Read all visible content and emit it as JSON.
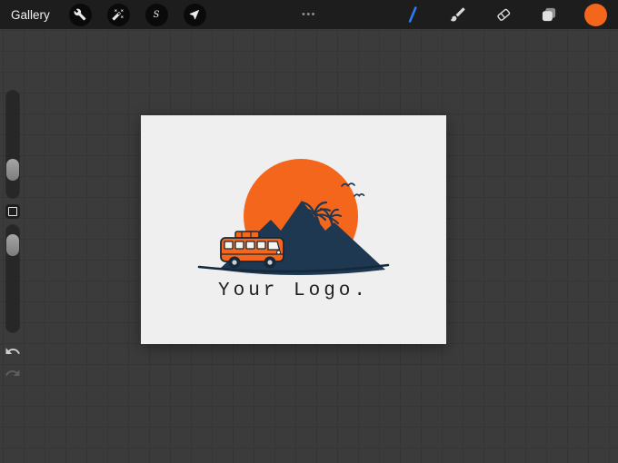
{
  "topbar": {
    "gallery_label": "Gallery",
    "more_glyph": "•••",
    "selection_glyph": "S",
    "left_tools": [
      {
        "name": "actions",
        "icon": "wrench-icon"
      },
      {
        "name": "adjustments",
        "icon": "magic-wand-icon"
      },
      {
        "name": "selection",
        "icon": "selection-s-icon"
      },
      {
        "name": "transform",
        "icon": "transform-arrow-icon"
      }
    ],
    "right_tools": [
      {
        "name": "stroke",
        "icon": "brush-stroke-icon"
      },
      {
        "name": "brush",
        "icon": "paintbrush-icon"
      },
      {
        "name": "erase",
        "icon": "eraser-icon"
      },
      {
        "name": "layers",
        "icon": "layers-icon"
      },
      {
        "name": "color",
        "icon": "color-swatch"
      }
    ],
    "colors": {
      "bar_bg": "#1d1d1d",
      "stroke_blue": "#2f7cf6",
      "swatch_orange": "#f4661b"
    }
  },
  "sidebar": {
    "items": [
      "brush-size-slider",
      "modify-button",
      "opacity-slider",
      "undo-button",
      "redo-button"
    ]
  },
  "canvas": {
    "logo": {
      "text": "Your Logo.",
      "colors": {
        "sun": "#f4661b",
        "mountain": "#1d3850",
        "outline": "#15293c",
        "van": "#f4661b",
        "window": "#f7f4ee",
        "text": "#1f1f1f",
        "canvas_bg": "#efeff0"
      }
    }
  }
}
